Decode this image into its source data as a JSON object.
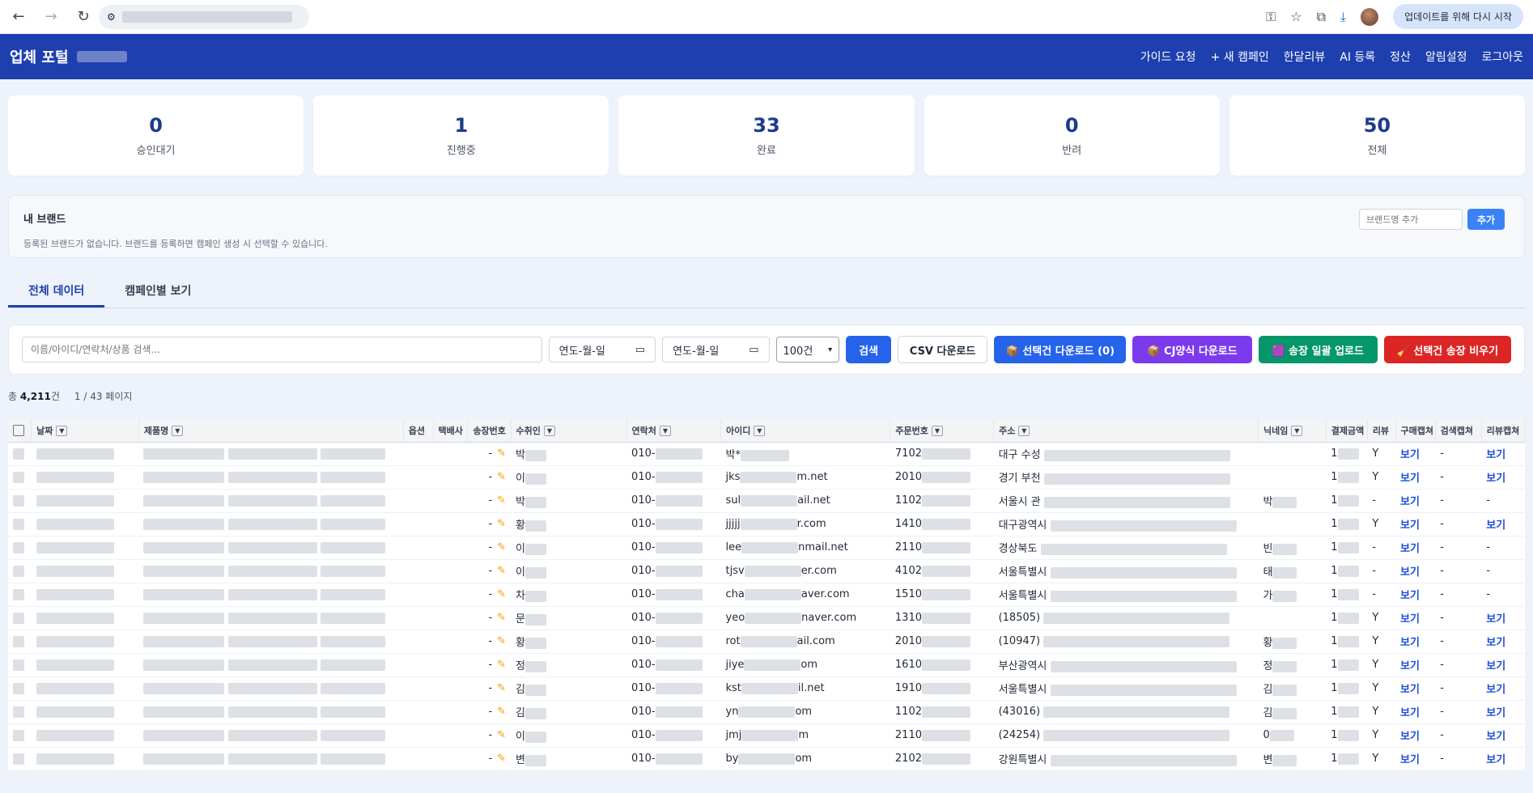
{
  "browser": {
    "update_label": "업데이트를 위해 다시 시작"
  },
  "header": {
    "title": "업체 포털",
    "menu": [
      "가이드 요청",
      "+ 새 캠페인",
      "한달리뷰",
      "AI 등록",
      "정산",
      "알림설정",
      "로그아웃"
    ]
  },
  "stats": [
    {
      "value": "0",
      "label": "승인대기"
    },
    {
      "value": "1",
      "label": "진행중"
    },
    {
      "value": "33",
      "label": "완료"
    },
    {
      "value": "0",
      "label": "반려"
    },
    {
      "value": "50",
      "label": "전체"
    }
  ],
  "brand": {
    "title": "내 브랜드",
    "description": "등록된 브랜드가 없습니다. 브랜드를 등록하면 캠페인 생성 시 선택할 수 있습니다.",
    "input_placeholder": "브랜드명 추가",
    "add_label": "추가"
  },
  "tabs": [
    "전체 데이터",
    "캠페인별 보기"
  ],
  "filter": {
    "search_placeholder": "이름/아이디/연락처/상품 검색...",
    "date_from": "연도-월-일",
    "date_to": "연도-월-일",
    "page_size": "100건",
    "search_label": "검색",
    "csv_label": "CSV 다운로드",
    "selected_download_label": "📦 선택건 다운로드 (0)",
    "cj_label": "📦 CJ양식 다운로드",
    "invoice_upload_label": "🟪 송장 일괄 업로드",
    "clear_invoice_label": "🧹 선택건 송장 비우기"
  },
  "summary": {
    "total_prefix": "총",
    "total_count": "4,211",
    "total_suffix": "건",
    "page": "1 / 43 페이지"
  },
  "table": {
    "headers": [
      "날짜",
      "제품명",
      "옵션",
      "택배사",
      "송장번호",
      "수취인",
      "연락처",
      "아이디",
      "주문번호",
      "주소",
      "닉네임",
      "결제금액",
      "리뷰",
      "구매캡쳐",
      "검색캡쳐",
      "리뷰캡쳐"
    ],
    "rows": [
      {
        "invoice": "-",
        "recipient": "박",
        "phone": "010-",
        "id": "박*",
        "order": "7102",
        "address": "대구 수성",
        "nickname": "",
        "amount": "1",
        "review": "Y",
        "purchase": "보기",
        "search": "-",
        "reviewcap": "보기"
      },
      {
        "invoice": "-",
        "recipient": "이",
        "phone": "010-",
        "id": "jks",
        "id_tail": "m.net",
        "order": "2010",
        "address": "경기 부천",
        "nickname": "",
        "amount": "1",
        "review": "Y",
        "purchase": "보기",
        "search": "-",
        "reviewcap": "보기"
      },
      {
        "invoice": "-",
        "recipient": "박",
        "phone": "010-",
        "id": "sul",
        "id_tail": "ail.net",
        "order": "1102",
        "address": "서울시 관",
        "nickname": "박",
        "amount": "1",
        "review": "-",
        "purchase": "보기",
        "search": "-",
        "reviewcap": "-"
      },
      {
        "invoice": "-",
        "recipient": "황",
        "phone": "010-",
        "id": "jjjjj",
        "id_tail": "r.com",
        "order": "1410",
        "address": "대구광역시",
        "nickname": "",
        "amount": "1",
        "review": "Y",
        "purchase": "보기",
        "search": "-",
        "reviewcap": "보기"
      },
      {
        "invoice": "-",
        "recipient": "이",
        "phone": "010-",
        "id": "lee",
        "id_tail": "nmail.net",
        "order": "2110",
        "address": "경상북도",
        "nickname": "빈",
        "amount": "1",
        "review": "-",
        "purchase": "보기",
        "search": "-",
        "reviewcap": "-"
      },
      {
        "invoice": "-",
        "recipient": "이",
        "phone": "010-",
        "id": "tjsv",
        "id_tail": "er.com",
        "order": "4102",
        "address": "서울특별시",
        "nickname": "태",
        "amount": "1",
        "review": "-",
        "purchase": "보기",
        "search": "-",
        "reviewcap": "-"
      },
      {
        "invoice": "-",
        "recipient": "차",
        "phone": "010-",
        "id": "cha",
        "id_tail": "aver.com",
        "order": "1510",
        "address": "서울특별시",
        "nickname": "가",
        "amount": "1",
        "review": "-",
        "purchase": "보기",
        "search": "-",
        "reviewcap": "-"
      },
      {
        "invoice": "-",
        "recipient": "문",
        "phone": "010-",
        "id": "yeo",
        "id_tail": "naver.com",
        "order": "1310",
        "address": "(18505)",
        "nickname": "",
        "amount": "1",
        "review": "Y",
        "purchase": "보기",
        "search": "-",
        "reviewcap": "보기"
      },
      {
        "invoice": "-",
        "recipient": "황",
        "phone": "010-",
        "id": "rot",
        "id_tail": "ail.com",
        "order": "2010",
        "address": "(10947)",
        "nickname": "황",
        "amount": "1",
        "review": "Y",
        "purchase": "보기",
        "search": "-",
        "reviewcap": "보기"
      },
      {
        "invoice": "-",
        "recipient": "정",
        "phone": "010-",
        "id": "jiye",
        "id_tail": "om",
        "order": "1610",
        "address": "부산광역시",
        "nickname": "정",
        "amount": "1",
        "review": "Y",
        "purchase": "보기",
        "search": "-",
        "reviewcap": "보기"
      },
      {
        "invoice": "-",
        "recipient": "김",
        "phone": "010-",
        "id": "kst",
        "id_tail": "il.net",
        "order": "1910",
        "address": "서울특별시",
        "nickname": "김",
        "amount": "1",
        "review": "Y",
        "purchase": "보기",
        "search": "-",
        "reviewcap": "보기"
      },
      {
        "invoice": "-",
        "recipient": "김",
        "phone": "010-",
        "id": "yn",
        "id_tail": "om",
        "order": "1102",
        "address": "(43016)",
        "nickname": "김",
        "amount": "1",
        "review": "Y",
        "purchase": "보기",
        "search": "-",
        "reviewcap": "보기"
      },
      {
        "invoice": "-",
        "recipient": "이",
        "phone": "010-",
        "id": "jmj",
        "id_tail": "m",
        "order": "2110",
        "address": "(24254)",
        "nickname": "0",
        "amount": "1",
        "review": "Y",
        "purchase": "보기",
        "search": "-",
        "reviewcap": "보기"
      },
      {
        "invoice": "-",
        "recipient": "변",
        "phone": "010-",
        "id": "by",
        "id_tail": "om",
        "order": "2102",
        "address": "강원특별시",
        "nickname": "변",
        "amount": "1",
        "review": "Y",
        "purchase": "보기",
        "search": "-",
        "reviewcap": "보기"
      }
    ]
  },
  "colors": {
    "header_bg": "#1e40af",
    "accent": "#2563eb",
    "purple": "#7c3aed",
    "green": "#059669",
    "red": "#dc2626"
  }
}
